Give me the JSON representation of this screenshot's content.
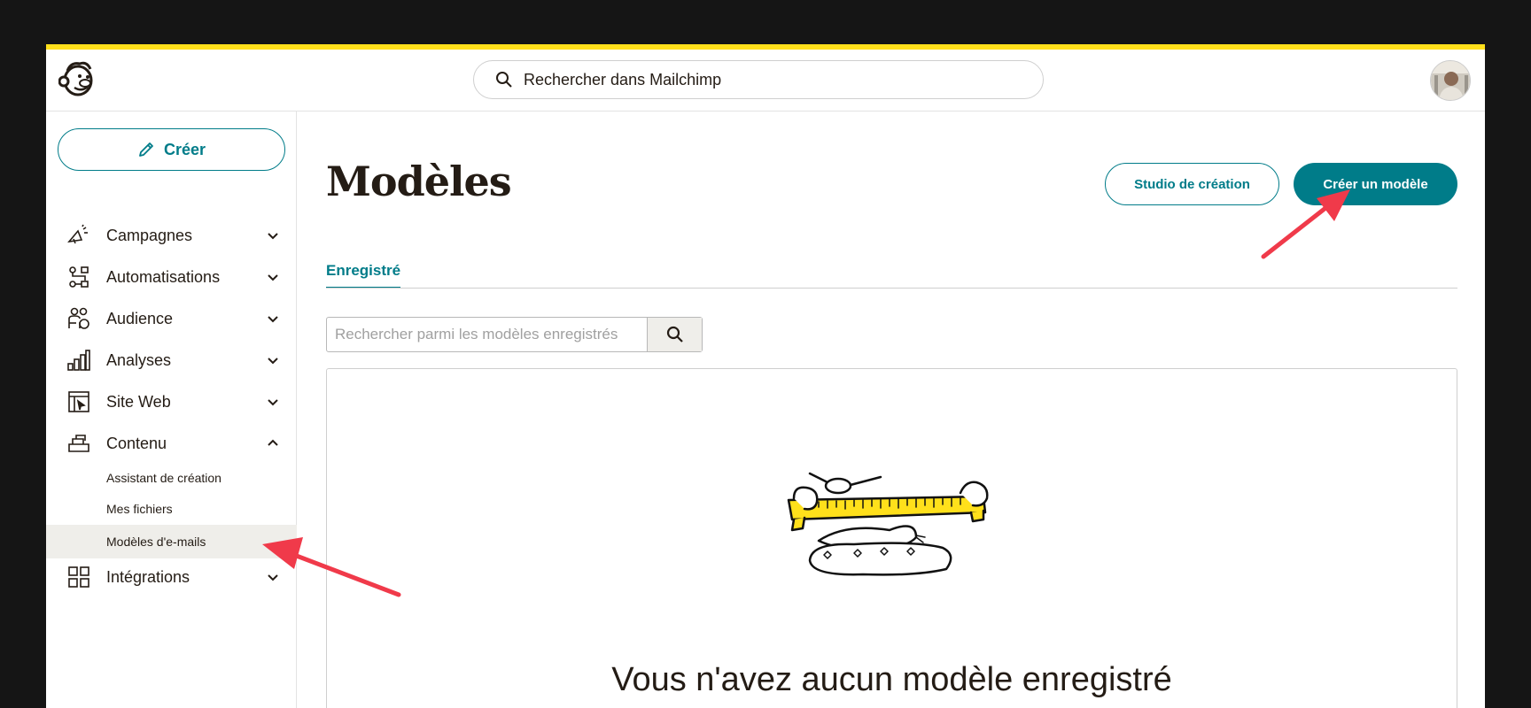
{
  "header": {
    "search_placeholder": "Rechercher dans Mailchimp"
  },
  "sidebar": {
    "create_label": "Créer",
    "items": [
      {
        "label": "Campagnes",
        "icon": "megaphone-icon",
        "expanded": false
      },
      {
        "label": "Automatisations",
        "icon": "automation-icon",
        "expanded": false
      },
      {
        "label": "Audience",
        "icon": "audience-icon",
        "expanded": false
      },
      {
        "label": "Analyses",
        "icon": "bar-chart-icon",
        "expanded": false
      },
      {
        "label": "Site Web",
        "icon": "website-icon",
        "expanded": false
      },
      {
        "label": "Contenu",
        "icon": "content-icon",
        "expanded": true
      },
      {
        "label": "Intégrations",
        "icon": "grid-icon",
        "expanded": false
      }
    ],
    "content_subitems": [
      {
        "label": "Assistant de création"
      },
      {
        "label": "Mes fichiers"
      },
      {
        "label": "Modèles d'e-mails",
        "active": true
      }
    ]
  },
  "main": {
    "title": "Modèles",
    "studio_button": "Studio de création",
    "create_template_button": "Créer un modèle",
    "tabs": [
      {
        "label": "Enregistré",
        "active": true
      }
    ],
    "template_search_placeholder": "Rechercher parmi les modèles enregistrés",
    "empty_state_text": "Vous n'avez aucun modèle enregistré"
  },
  "colors": {
    "accent": "#ffe01b",
    "brand_teal": "#007c89",
    "annotation_arrow": "#f03a4a",
    "active_sidebar_bg": "#efeeea"
  }
}
